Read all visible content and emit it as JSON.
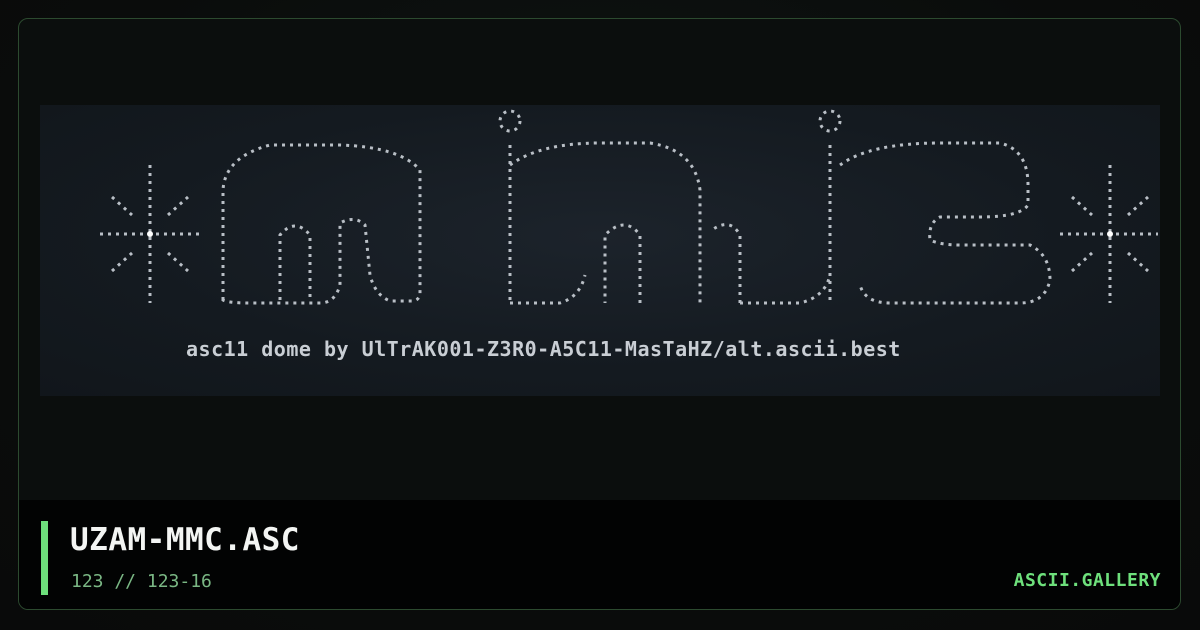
{
  "art": {
    "credit_line": "asc11 dome by UlTrAK001-Z3R0-A5C11-MasTaHZ/alt.ascii.best"
  },
  "footer": {
    "title": "UZAM-MMC.ASC",
    "subtitle": "123 // 123-16",
    "brand": "ASCII.GALLERY"
  },
  "colors": {
    "accent": "#6ee07c",
    "subtitle": "#7ab784",
    "art_text": "#c9ced4",
    "art_background": "#141a20",
    "card_border": "#2c4a2f"
  }
}
